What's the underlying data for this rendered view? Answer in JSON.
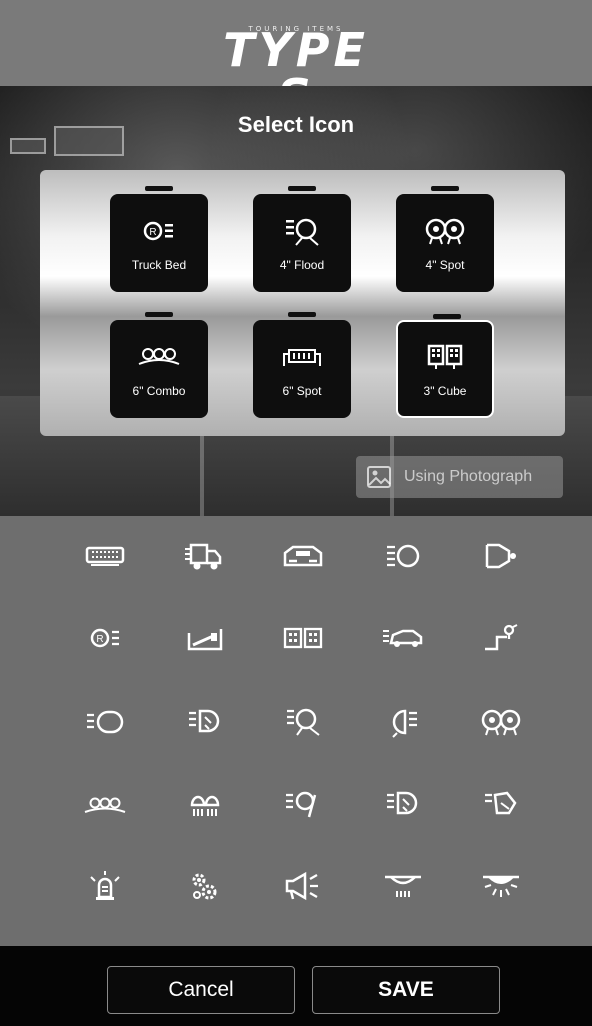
{
  "header": {
    "logo_small": "TOURING ITEMS",
    "logo_main": "TYPE S"
  },
  "hero": {
    "title": "Select Icon"
  },
  "preview_tiles": [
    {
      "label": "Truck Bed",
      "icon": "truck-bed-icon",
      "selected": false
    },
    {
      "label": "4\" Flood",
      "icon": "flood-light-icon",
      "selected": false
    },
    {
      "label": "4\" Spot",
      "icon": "spot-light-icon",
      "selected": false
    },
    {
      "label": "6\" Combo",
      "icon": "combo-bar-icon",
      "selected": false
    },
    {
      "label": "6\" Spot",
      "icon": "light-bar-icon",
      "selected": false
    },
    {
      "label": "3\" Cube",
      "icon": "cube-light-icon",
      "selected": true
    }
  ],
  "using_photograph": {
    "label": "Using Photograph",
    "icon": "image-icon"
  },
  "icon_grid": [
    [
      "light-bar-icon",
      "truck-icon",
      "bumper-icon",
      "headlight-beam-icon",
      "spotlight-icon"
    ],
    [
      "truck-bed-icon",
      "ramp-icon",
      "cube-light-icon",
      "car-icon",
      "hitch-icon"
    ],
    [
      "flood-light-icon",
      "bulb-beam-icon",
      "flood-light-icon",
      "side-beam-icon",
      "spot-light-icon"
    ],
    [
      "combo-bar-icon",
      "pod-light-icon",
      "flood-tilt-icon",
      "bulb-beam-icon",
      "bulb-tilt-icon"
    ],
    [
      "beacon-icon",
      "gears-icon",
      "horn-icon",
      "dome-light-icon",
      "dome-glow-icon"
    ]
  ],
  "footer": {
    "cancel_label": "Cancel",
    "save_label": "SAVE"
  },
  "colors": {
    "header_bg": "#7a7a7a",
    "grid_bg": "#6e6e6e",
    "footer_bg": "#050505",
    "tile_bg": "#0e0e0e"
  }
}
